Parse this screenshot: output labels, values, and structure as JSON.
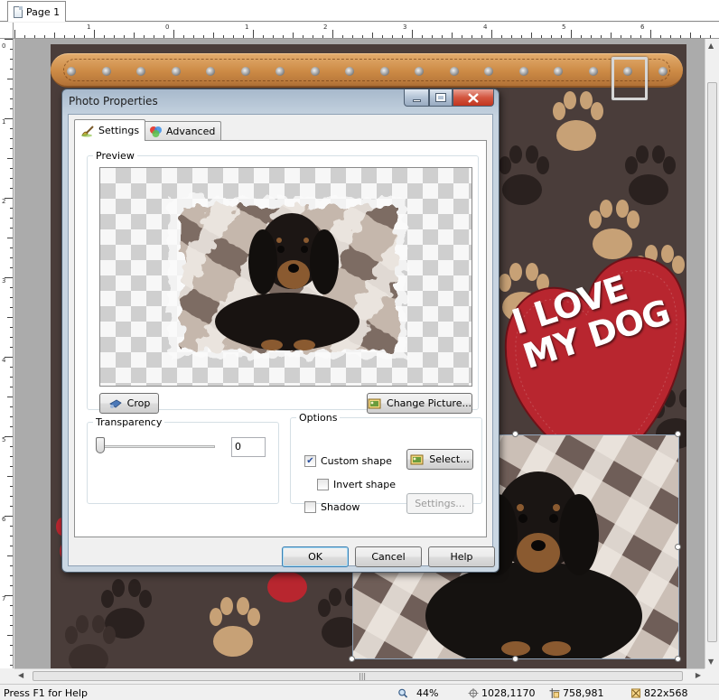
{
  "document": {
    "tab_label": "Page 1"
  },
  "ruler": {
    "h_numbers": [
      "1",
      "0",
      "1",
      "2",
      "3",
      "4",
      "5",
      "6"
    ],
    "v_numbers": [
      "0",
      "1",
      "2",
      "3",
      "4",
      "5",
      "6",
      "7"
    ]
  },
  "canvas": {
    "heart_text": "I LOVE MY DOG"
  },
  "dialog": {
    "title": "Photo Properties",
    "tabs": [
      {
        "label": "Settings",
        "active": true
      },
      {
        "label": "Advanced",
        "active": false
      }
    ],
    "preview_group": "Preview",
    "crop_label": "Crop",
    "change_picture_label": "Change Picture...",
    "transparency_group": "Transparency",
    "transparency_value": "0",
    "options_group": "Options",
    "custom_shape_label": "Custom shape",
    "custom_shape_checked": true,
    "invert_shape_label": "Invert shape",
    "invert_shape_checked": false,
    "shadow_label": "Shadow",
    "shadow_checked": false,
    "select_label": "Select...",
    "shadow_settings_label": "Settings...",
    "ok_label": "OK",
    "cancel_label": "Cancel",
    "help_label": "Help"
  },
  "statusbar": {
    "help_text": "Press F1 for Help",
    "zoom": "44%",
    "cursor_position": "1028,1170",
    "object_position": "758,981",
    "object_size": "822x568"
  },
  "colors": {
    "heart_red": "#b8262f",
    "strap_tan": "#cc8a45",
    "background_brown": "#4a3d3a",
    "close_button_red": "#c1351f"
  }
}
